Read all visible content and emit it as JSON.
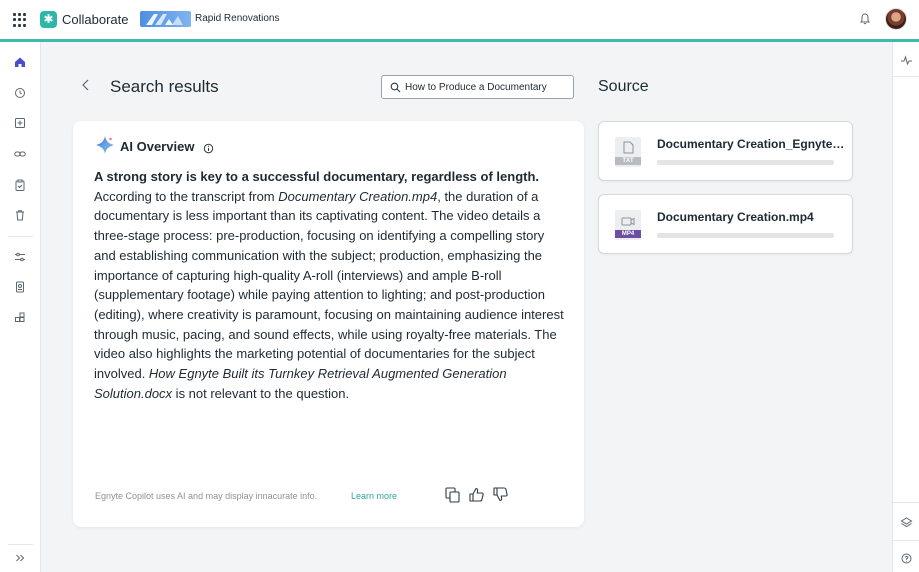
{
  "app": {
    "name": "Collaborate",
    "tenant": "Rapid Renovations"
  },
  "header": {
    "title": "Search results",
    "search_value": "How to Produce a Documentary"
  },
  "ai_overview": {
    "title": "AI Overview",
    "headline": "A strong story is key to a successful documentary, regardless of length.",
    "p_before_file1": "According to the transcript from ",
    "file1": "Documentary Creation.mp4",
    "p_after_file1": ", the duration of a documentary is less important than its captivating content. The video details a three-stage process: pre-production, focusing on identifying a compelling story and establishing communication with the subject; production, emphasizing the importance of capturing high-quality A-roll (interviews) and ample B-roll (supplementary footage) while paying attention to lighting; and post-production (editing), where creativity is paramount, focusing on maintaining audience interest through music, pacing, and sound effects, while using royalty-free materials. The video also highlights the marketing potential of documentaries for the subject involved. ",
    "file2": "How Egnyte Built its Turnkey Retrieval Augmented Generation Solution.docx",
    "p_after_file2": " is not relevant to the question.",
    "disclaimer": "Egnyte Copilot uses AI and may display innacurate info.",
    "learn_more": "Learn more",
    "icons": [
      "copy-icon",
      "thumbs-up-icon",
      "thumbs-down-icon"
    ]
  },
  "source": {
    "title": "Source",
    "items": [
      {
        "name": "Documentary Creation_EgnyteTr...",
        "type_label": "TXT",
        "badge_color": "#b7bcc0"
      },
      {
        "name": "Documentary Creation.mp4",
        "type_label": "MP4",
        "badge_color": "#6c4fa3"
      }
    ]
  },
  "sidebar": {
    "icons": [
      "home-icon",
      "clock-icon",
      "upload-icon",
      "link-icon",
      "clipboard-icon",
      "trash-icon",
      "sliders-icon",
      "document-badge-icon",
      "apps-add-icon"
    ],
    "expand_icon": "double-chevron-right-icon"
  },
  "colors": {
    "accent": "#3fb8ad",
    "link": "#2fa89d",
    "sidebar_active": "#4a4fc6"
  }
}
